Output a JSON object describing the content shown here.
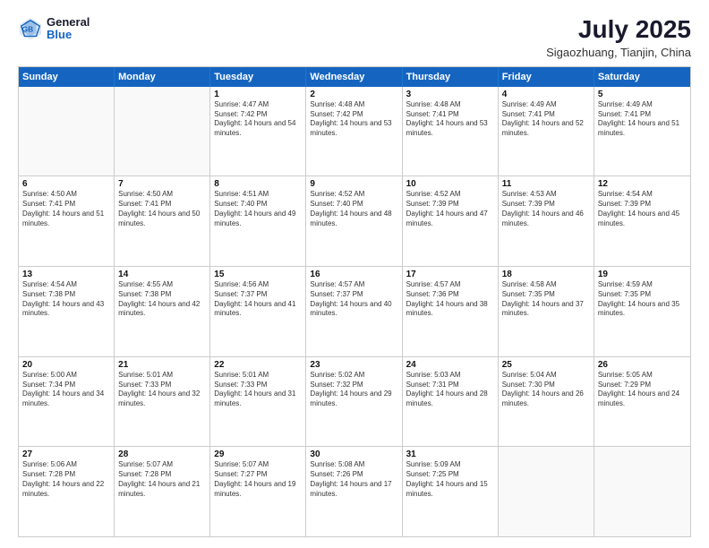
{
  "header": {
    "logo": {
      "line1": "General",
      "line2": "Blue"
    },
    "title": "July 2025",
    "location": "Sigaozhuang, Tianjin, China"
  },
  "dayNames": [
    "Sunday",
    "Monday",
    "Tuesday",
    "Wednesday",
    "Thursday",
    "Friday",
    "Saturday"
  ],
  "weeks": [
    [
      {
        "day": "",
        "empty": true
      },
      {
        "day": "",
        "empty": true
      },
      {
        "day": "1",
        "sunrise": "4:47 AM",
        "sunset": "7:42 PM",
        "daylight": "14 hours and 54 minutes."
      },
      {
        "day": "2",
        "sunrise": "4:48 AM",
        "sunset": "7:42 PM",
        "daylight": "14 hours and 53 minutes."
      },
      {
        "day": "3",
        "sunrise": "4:48 AM",
        "sunset": "7:41 PM",
        "daylight": "14 hours and 53 minutes."
      },
      {
        "day": "4",
        "sunrise": "4:49 AM",
        "sunset": "7:41 PM",
        "daylight": "14 hours and 52 minutes."
      },
      {
        "day": "5",
        "sunrise": "4:49 AM",
        "sunset": "7:41 PM",
        "daylight": "14 hours and 51 minutes."
      }
    ],
    [
      {
        "day": "6",
        "sunrise": "4:50 AM",
        "sunset": "7:41 PM",
        "daylight": "14 hours and 51 minutes."
      },
      {
        "day": "7",
        "sunrise": "4:50 AM",
        "sunset": "7:41 PM",
        "daylight": "14 hours and 50 minutes."
      },
      {
        "day": "8",
        "sunrise": "4:51 AM",
        "sunset": "7:40 PM",
        "daylight": "14 hours and 49 minutes."
      },
      {
        "day": "9",
        "sunrise": "4:52 AM",
        "sunset": "7:40 PM",
        "daylight": "14 hours and 48 minutes."
      },
      {
        "day": "10",
        "sunrise": "4:52 AM",
        "sunset": "7:39 PM",
        "daylight": "14 hours and 47 minutes."
      },
      {
        "day": "11",
        "sunrise": "4:53 AM",
        "sunset": "7:39 PM",
        "daylight": "14 hours and 46 minutes."
      },
      {
        "day": "12",
        "sunrise": "4:54 AM",
        "sunset": "7:39 PM",
        "daylight": "14 hours and 45 minutes."
      }
    ],
    [
      {
        "day": "13",
        "sunrise": "4:54 AM",
        "sunset": "7:38 PM",
        "daylight": "14 hours and 43 minutes."
      },
      {
        "day": "14",
        "sunrise": "4:55 AM",
        "sunset": "7:38 PM",
        "daylight": "14 hours and 42 minutes."
      },
      {
        "day": "15",
        "sunrise": "4:56 AM",
        "sunset": "7:37 PM",
        "daylight": "14 hours and 41 minutes."
      },
      {
        "day": "16",
        "sunrise": "4:57 AM",
        "sunset": "7:37 PM",
        "daylight": "14 hours and 40 minutes."
      },
      {
        "day": "17",
        "sunrise": "4:57 AM",
        "sunset": "7:36 PM",
        "daylight": "14 hours and 38 minutes."
      },
      {
        "day": "18",
        "sunrise": "4:58 AM",
        "sunset": "7:35 PM",
        "daylight": "14 hours and 37 minutes."
      },
      {
        "day": "19",
        "sunrise": "4:59 AM",
        "sunset": "7:35 PM",
        "daylight": "14 hours and 35 minutes."
      }
    ],
    [
      {
        "day": "20",
        "sunrise": "5:00 AM",
        "sunset": "7:34 PM",
        "daylight": "14 hours and 34 minutes."
      },
      {
        "day": "21",
        "sunrise": "5:01 AM",
        "sunset": "7:33 PM",
        "daylight": "14 hours and 32 minutes."
      },
      {
        "day": "22",
        "sunrise": "5:01 AM",
        "sunset": "7:33 PM",
        "daylight": "14 hours and 31 minutes."
      },
      {
        "day": "23",
        "sunrise": "5:02 AM",
        "sunset": "7:32 PM",
        "daylight": "14 hours and 29 minutes."
      },
      {
        "day": "24",
        "sunrise": "5:03 AM",
        "sunset": "7:31 PM",
        "daylight": "14 hours and 28 minutes."
      },
      {
        "day": "25",
        "sunrise": "5:04 AM",
        "sunset": "7:30 PM",
        "daylight": "14 hours and 26 minutes."
      },
      {
        "day": "26",
        "sunrise": "5:05 AM",
        "sunset": "7:29 PM",
        "daylight": "14 hours and 24 minutes."
      }
    ],
    [
      {
        "day": "27",
        "sunrise": "5:06 AM",
        "sunset": "7:28 PM",
        "daylight": "14 hours and 22 minutes."
      },
      {
        "day": "28",
        "sunrise": "5:07 AM",
        "sunset": "7:28 PM",
        "daylight": "14 hours and 21 minutes."
      },
      {
        "day": "29",
        "sunrise": "5:07 AM",
        "sunset": "7:27 PM",
        "daylight": "14 hours and 19 minutes."
      },
      {
        "day": "30",
        "sunrise": "5:08 AM",
        "sunset": "7:26 PM",
        "daylight": "14 hours and 17 minutes."
      },
      {
        "day": "31",
        "sunrise": "5:09 AM",
        "sunset": "7:25 PM",
        "daylight": "14 hours and 15 minutes."
      },
      {
        "day": "",
        "empty": true
      },
      {
        "day": "",
        "empty": true
      }
    ]
  ]
}
